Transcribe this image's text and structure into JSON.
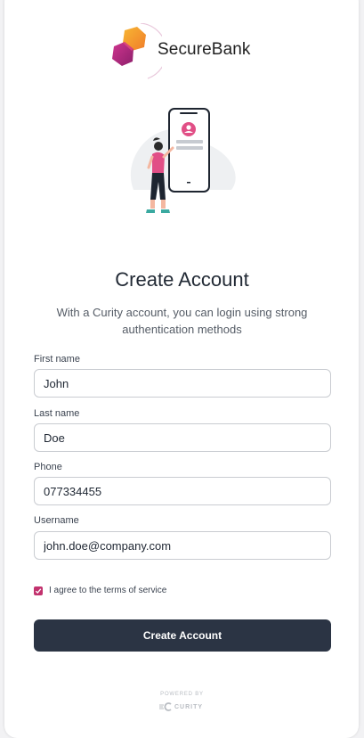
{
  "brand": {
    "name": "SecureBank"
  },
  "heading": {
    "title": "Create Account",
    "subtitle": "With a Curity account, you can login using strong authentication methods"
  },
  "form": {
    "fields": [
      {
        "label": "First name",
        "value": "John"
      },
      {
        "label": "Last name",
        "value": "Doe"
      },
      {
        "label": "Phone",
        "value": "077334455"
      },
      {
        "label": "Username",
        "value": "john.doe@company.com"
      }
    ],
    "terms": {
      "label": "I agree to the terms of service",
      "checked": true
    },
    "submit_label": "Create Account"
  },
  "footer": {
    "powered_by": "POWERED BY",
    "vendor": "CURITY"
  },
  "colors": {
    "accent": "#c2326e",
    "button": "#2b3444",
    "logo_orange": "#f5a623",
    "logo_magenta": "#b5267a"
  },
  "icons": [
    "securebank-logo-icon",
    "user-phone-illustration",
    "checkmark-icon",
    "curity-logo-icon"
  ]
}
